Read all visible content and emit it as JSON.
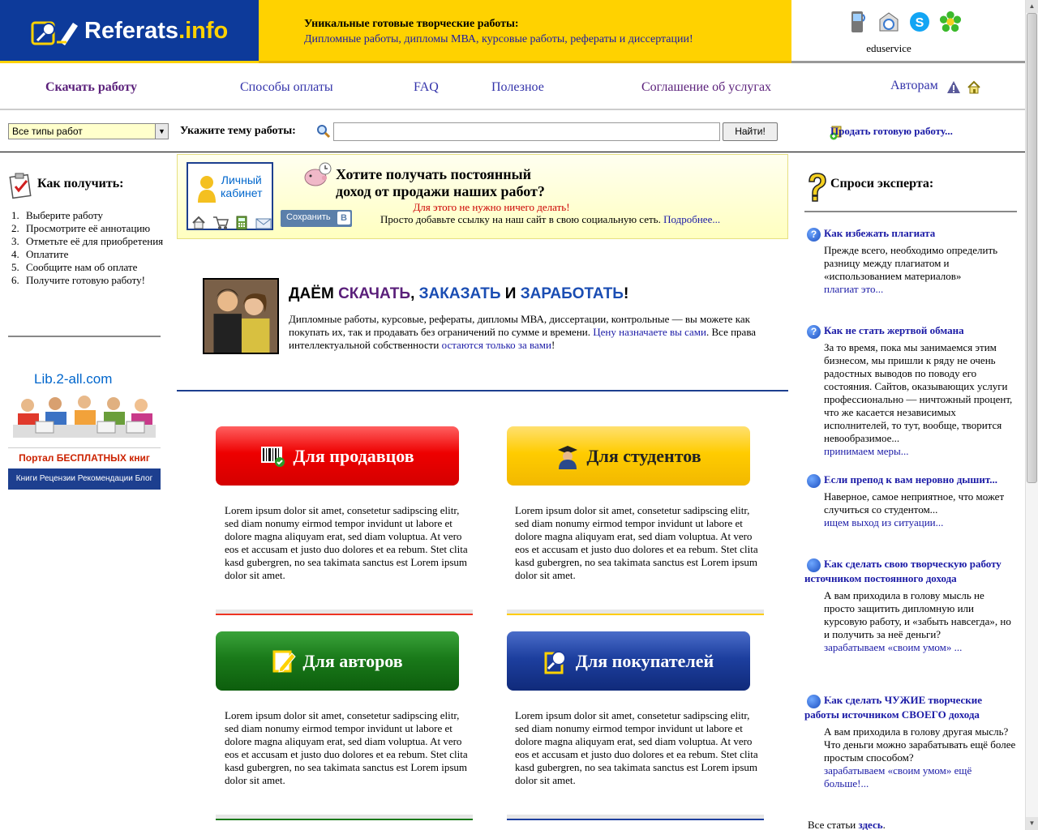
{
  "header": {
    "logo_main": "Referats",
    "logo_tld": ".info",
    "promo_heading": "Уникальные готовые творческие работы:",
    "promo_sub": "Дипломные работы, дипломы МВА, курсовые работы, рефераты и диссертации!",
    "contact_name": "eduservice",
    "contact_icons": [
      "mobile-icon",
      "email-icon",
      "skype-icon",
      "icq-icon"
    ]
  },
  "nav": {
    "items": [
      "Скачать работу",
      "Способы оплаты",
      "FAQ",
      "Полезное",
      "Соглашение об услугах",
      "Авторам"
    ]
  },
  "search": {
    "type_selected": "Все типы работ",
    "label": "Укажите тему работы:",
    "value": "",
    "button": "Найти!",
    "sell_link": "Продать готовую работу..."
  },
  "left": {
    "how_title": "Как получить:",
    "steps": [
      {
        "n": "1.",
        "text": "Выберите работу"
      },
      {
        "n": "2.",
        "text": "Просмотрите её аннотацию"
      },
      {
        "n": "3.",
        "text": "Отметьте её для приобретения"
      },
      {
        "n": "4.",
        "text": "Оплатите"
      },
      {
        "n": "5.",
        "text": "Сообщите нам об оплате"
      },
      {
        "n": "6.",
        "text": "Получите готовую работу!"
      }
    ],
    "lib_name": "Lib.2-all.com",
    "lib_portal": "Портал БЕСПЛАТНЫХ книг",
    "lib_bar": "Книги Рецензии Рекомендации Блог"
  },
  "income": {
    "cabinet_line1": "Личный",
    "cabinet_line2": "кабинет",
    "vk_save": "Сохранить",
    "vk_letter": "В",
    "question": "Хотите получать постоянный доход от продажи наших работ?",
    "red_note": "Для этого не нужно ничего делать!",
    "text": "Просто добавьте ссылку на наш сайт в свою социальную сеть.",
    "more": "Подробнее..."
  },
  "intro": {
    "h_prefix": "ДАЁМ ",
    "h_w1": "СКАЧАТЬ",
    "h_sep": ", ",
    "h_w2": "ЗАКАЗАТЬ",
    "h_and": " И ",
    "h_w3": "ЗАРАБОТАТЬ",
    "h_end": "!",
    "d1": "Дипломные работы, курсовые, рефераты, дипломы МВА, диссертации, контрольные — вы можете как покупать их, так и продавать без ограничений по сумме и времени.",
    "d_link1": "Цену назначаете вы сами",
    "d2": ". Все права интеллектуальной собственности",
    "d_link2": "остаются только за вами",
    "d3": "!"
  },
  "cta": {
    "sellers": "Для продавцов",
    "students": "Для студентов",
    "authors": "Для авторов",
    "buyers": "Для покупателей",
    "lorem": "Lorem ipsum dolor sit amet, consetetur sadipscing elitr, sed diam nonumy eirmod tempor invidunt ut labore et dolore magna aliquyam erat, sed diam voluptua. At vero eos et accusam et justo duo dolores et ea rebum. Stet clita kasd gubergren, no sea takimata sanctus est Lorem ipsum dolor sit amet."
  },
  "expert": {
    "title": "Спроси эксперта:",
    "items": [
      {
        "q": "Как избежать плагиата",
        "a": "Прежде всего, необходимо определить разницу между плагиатом и «использованием материалов»",
        "link": "плагиат это..."
      },
      {
        "q": "Как не стать жертвой обмана",
        "a": "За то время, пока мы занимаемся этим бизнесом, мы пришли к ряду не очень радостных выводов по поводу его состояния. Сайтов, оказывающих услуги профессионально — ничтожный процент, что же касается независимых исполнителей, то тут, вообще, творится невообразимое...",
        "link": "принимаем меры..."
      },
      {
        "q": "Если препод к вам неровно дышит...",
        "a": "Наверное, самое неприятное, что может случиться со студентом...",
        "link": "ищем выход из ситуации..."
      },
      {
        "q": "Как сделать свою творческую работу источником постоянного дохода",
        "a": "А вам приходила в голову мысль не просто защитить дипломную или курсовую работу, и «забыть навсегда», но и получить за неё деньги?",
        "link": "зарабатываем «своим умом» ..."
      },
      {
        "q": "Как сделать ЧУЖИЕ творческие работы источником СВОЕГО дохода",
        "a": "А вам приходила в голову другая мысль? Что деньги можно зарабатывать ещё более простым способом?",
        "link": "зарабатываем «своим умом» ещё больше!..."
      }
    ],
    "all_prefix": "Все статьи",
    "all_link": "здесь",
    "all_suffix": "."
  },
  "colors": {
    "brand_blue": "#0d3a9a",
    "brand_yellow": "#ffd200",
    "link": "#1a1aa6",
    "accent_purple": "#5a1f7a"
  }
}
